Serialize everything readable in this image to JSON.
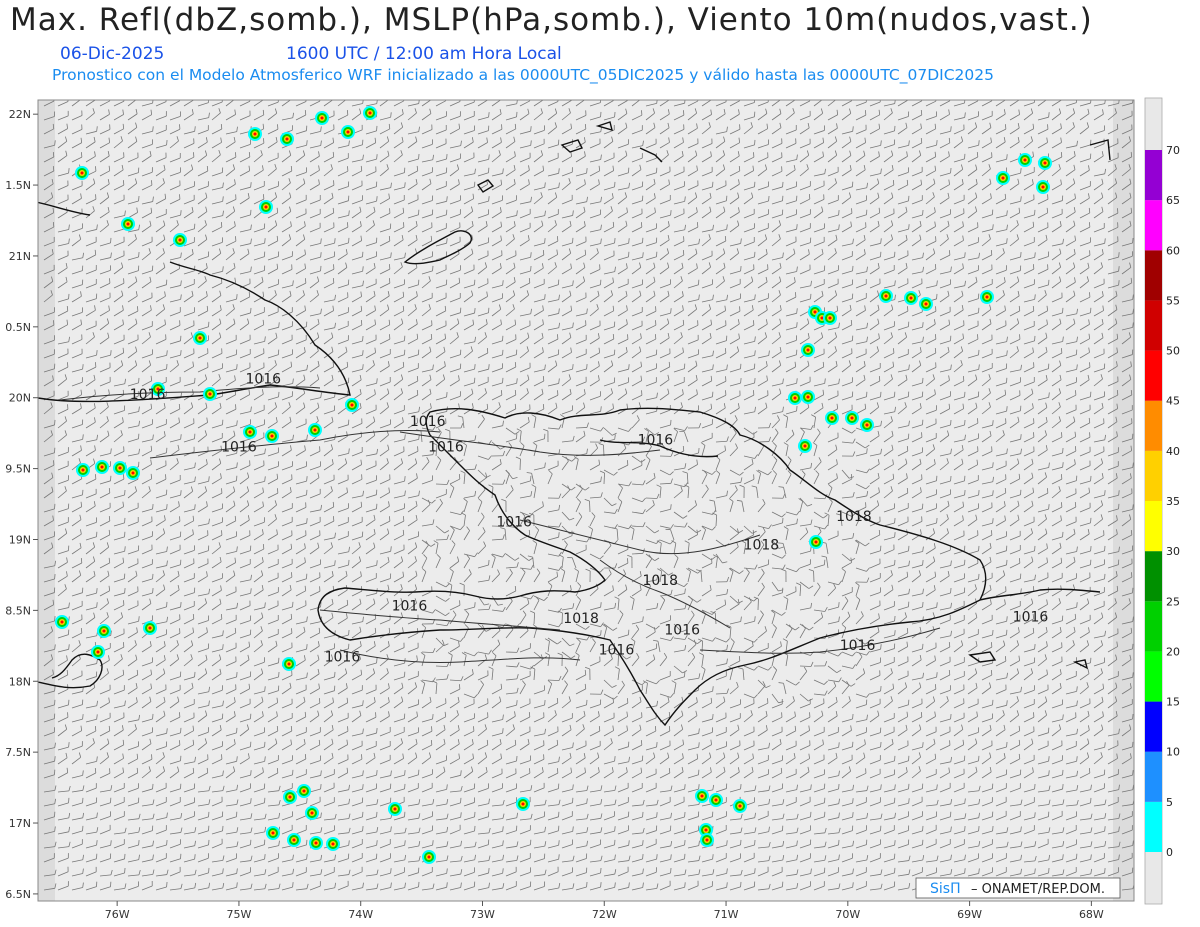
{
  "header": {
    "title": "Max. Refl(dbZ,somb.), MSLP(hPa,somb.), Viento 10m(nudos,vast.)",
    "date": "06-Dic-2025",
    "time": "1600 UTC / 12:00 am Hora Local",
    "info": "Pronostico con el Modelo Atmosferico WRF inicializado a las 0000UTC_05DIC2025 y válido hasta las  0000UTC_07DIC2025"
  },
  "chart_data": {
    "type": "map",
    "xaxis": {
      "ticks": [
        "76W",
        "75W",
        "74W",
        "73W",
        "72W",
        "71W",
        "70W",
        "69W",
        "68W"
      ],
      "range": [
        -76.65,
        -67.65
      ]
    },
    "yaxis": {
      "ticks": [
        "22N",
        "1.5N",
        "21N",
        "0.5N",
        "20N",
        "9.5N",
        "19N",
        "8.5N",
        "18N",
        "7.5N",
        "17N",
        "6.5N"
      ],
      "range": [
        16.45,
        22.1
      ]
    },
    "isobars": [
      {
        "label": "1016",
        "lon": -75.75,
        "lat": 19.99
      },
      {
        "label": "1016",
        "lon": -74.8,
        "lat": 20.1
      },
      {
        "label": "1016",
        "lon": -75.0,
        "lat": 19.62
      },
      {
        "label": "1016",
        "lon": -73.45,
        "lat": 19.8
      },
      {
        "label": "1016",
        "lon": -73.3,
        "lat": 19.62
      },
      {
        "label": "1016",
        "lon": -71.58,
        "lat": 19.67
      },
      {
        "label": "1016",
        "lon": -72.74,
        "lat": 19.09
      },
      {
        "label": "1018",
        "lon": -69.95,
        "lat": 19.13
      },
      {
        "label": "1018",
        "lon": -70.71,
        "lat": 18.93
      },
      {
        "label": "1018",
        "lon": -71.54,
        "lat": 18.68
      },
      {
        "label": "1018",
        "lon": -72.19,
        "lat": 18.41
      },
      {
        "label": "1016",
        "lon": -73.6,
        "lat": 18.5
      },
      {
        "label": "1016",
        "lon": -71.36,
        "lat": 18.33
      },
      {
        "label": "1016",
        "lon": -71.9,
        "lat": 18.19
      },
      {
        "label": "1016",
        "lon": -74.15,
        "lat": 18.14
      },
      {
        "label": "1016",
        "lon": -69.92,
        "lat": 18.22
      },
      {
        "label": "1016",
        "lon": -68.5,
        "lat": 18.42
      }
    ],
    "colorbar": {
      "ticks": [
        "0",
        "5",
        "10",
        "15",
        "20",
        "25",
        "30",
        "35",
        "40",
        "45",
        "50",
        "55",
        "60",
        "65",
        "70"
      ],
      "colors": [
        "#00ffff",
        "#1e90ff",
        "#0000ff",
        "#00ff00",
        "#00d000",
        "#009000",
        "#ffff00",
        "#ffd000",
        "#ff8c00",
        "#ff0000",
        "#d00000",
        "#a00000",
        "#ff00ff",
        "#9400d3"
      ]
    },
    "wind": {
      "dominant_direction": "east-northeast",
      "units": "nudos"
    },
    "grid": false
  },
  "credit": {
    "brand": "SisΠ",
    "text": "– ONAMET/REP.DOM."
  }
}
